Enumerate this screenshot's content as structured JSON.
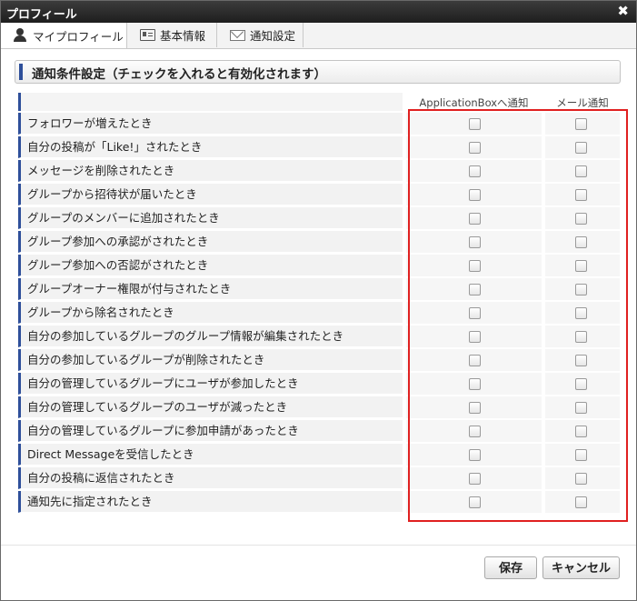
{
  "window": {
    "title": "プロフィール",
    "close_glyph": "✖"
  },
  "tabs": [
    {
      "label": "マイプロフィール",
      "icon": "person-icon"
    },
    {
      "label": "基本情報",
      "icon": "id-card-icon"
    },
    {
      "label": "通知設定",
      "icon": "mail-icon"
    }
  ],
  "section": {
    "title": "通知条件設定（チェックを入れると有効化されます）"
  },
  "columns": {
    "app": "ApplicationBoxへ通知",
    "mail": "メール通知"
  },
  "rows": [
    {
      "label": "フォロワーが増えたとき",
      "app": false,
      "mail": false
    },
    {
      "label": "自分の投稿が「Like!」されたとき",
      "app": false,
      "mail": false
    },
    {
      "label": "メッセージを削除されたとき",
      "app": false,
      "mail": false
    },
    {
      "label": "グループから招待状が届いたとき",
      "app": false,
      "mail": false
    },
    {
      "label": "グループのメンバーに追加されたとき",
      "app": false,
      "mail": false
    },
    {
      "label": "グループ参加への承認がされたとき",
      "app": false,
      "mail": false
    },
    {
      "label": "グループ参加への否認がされたとき",
      "app": false,
      "mail": false
    },
    {
      "label": "グループオーナー権限が付与されたとき",
      "app": false,
      "mail": false
    },
    {
      "label": "グループから除名されたとき",
      "app": false,
      "mail": false
    },
    {
      "label": "自分の参加しているグループのグループ情報が編集されたとき",
      "app": false,
      "mail": false
    },
    {
      "label": "自分の参加しているグループが削除されたとき",
      "app": false,
      "mail": false
    },
    {
      "label": "自分の管理しているグループにユーザが参加したとき",
      "app": false,
      "mail": false
    },
    {
      "label": "自分の管理しているグループのユーザが減ったとき",
      "app": false,
      "mail": false
    },
    {
      "label": "自分の管理しているグループに参加申請があったとき",
      "app": false,
      "mail": false
    },
    {
      "label": "Direct Messageを受信したとき",
      "app": false,
      "mail": false
    },
    {
      "label": "自分の投稿に返信されたとき",
      "app": false,
      "mail": false
    },
    {
      "label": "通知先に指定されたとき",
      "app": false,
      "mail": false
    }
  ],
  "buttons": {
    "save": "保存",
    "cancel": "キャンセル"
  },
  "colors": {
    "accent": "#2e4f9a",
    "highlight": "#e02020",
    "titlebar": "#2a2a2a"
  }
}
